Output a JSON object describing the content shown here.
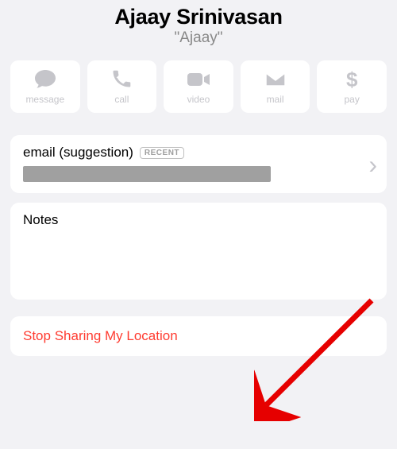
{
  "contact": {
    "name": "Ajaay Srinivasan",
    "nickname": "\"Ajaay\""
  },
  "actions": {
    "message": "message",
    "call": "call",
    "video": "video",
    "mail": "mail",
    "pay": "pay",
    "pay_symbol": "$"
  },
  "email": {
    "label": "email (suggestion)",
    "badge": "RECENT"
  },
  "notes": {
    "label": "Notes"
  },
  "stop_sharing": {
    "label": "Stop Sharing My Location"
  },
  "colors": {
    "destructive": "#ff3b30",
    "disabled": "#c5c5ca"
  }
}
